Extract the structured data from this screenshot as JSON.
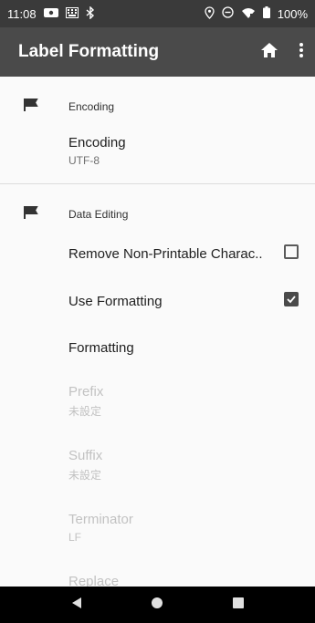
{
  "status_bar": {
    "time": "11:08",
    "battery": "100%",
    "icons_left": [
      "card-icon",
      "keyboard-icon",
      "bluetooth-icon"
    ],
    "icons_right": [
      "location-icon",
      "dnd-icon",
      "wifi-icon",
      "battery-icon"
    ]
  },
  "app_bar": {
    "title": "Label Formatting",
    "icons": [
      "home-icon",
      "more-vert-icon"
    ]
  },
  "sections": {
    "encoding": {
      "title": "Encoding",
      "pref_title": "Encoding",
      "pref_value": "UTF-8"
    },
    "data_editing": {
      "title": "Data Editing",
      "remove_nonprintable": {
        "label": "Remove Non-Printable Charac..",
        "checked": false
      },
      "use_formatting": {
        "label": "Use Formatting",
        "checked": true
      },
      "formatting": {
        "label": "Formatting"
      },
      "prefix": {
        "label": "Prefix",
        "value": "未設定"
      },
      "suffix": {
        "label": "Suffix",
        "value": "未設定"
      },
      "terminator": {
        "label": "Terminator",
        "value": "LF"
      },
      "replace": {
        "label": "Replace"
      }
    }
  },
  "colors": {
    "status_bar": "#3a3a3a",
    "app_bar": "#4a4a4a",
    "background": "#fafafa",
    "disabled_text": "#c2c2c2"
  },
  "nav": [
    "back-icon",
    "home-nav-icon",
    "recents-icon"
  ]
}
